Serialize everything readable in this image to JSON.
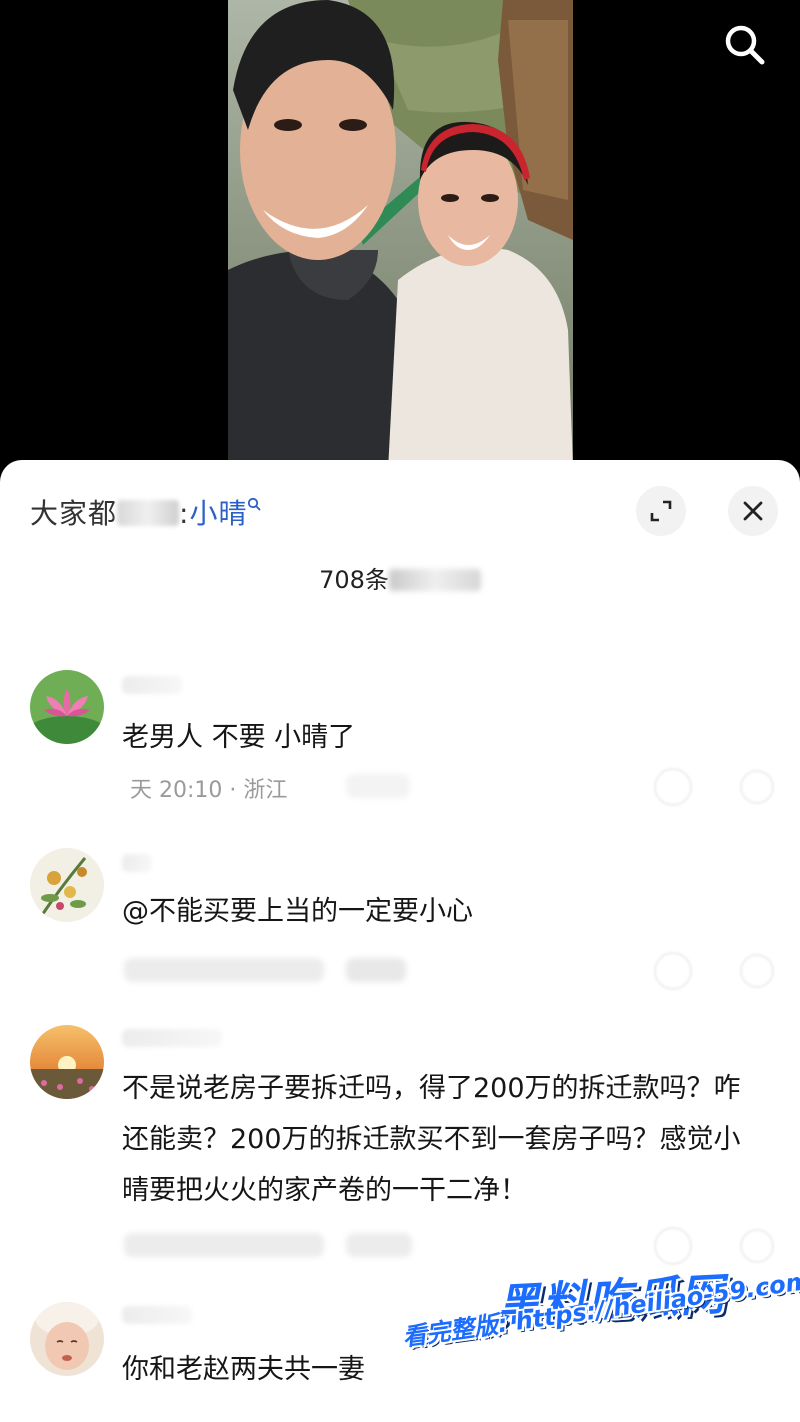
{
  "search": {
    "icon": "search-icon"
  },
  "header": {
    "prefix": "大家都",
    "colon": ":",
    "term": "小晴",
    "expand_icon": "expand-icon",
    "close_icon": "close-icon"
  },
  "comments_header": {
    "count": "708",
    "unit": "条"
  },
  "comments": [
    {
      "text": "老男人 不要 小晴了",
      "time": "天 20:10",
      "location": "浙江",
      "avatar": "lotus-avatar"
    },
    {
      "text": "@不能买要上当的一定要小心",
      "avatar": "flower-painting-avatar"
    },
    {
      "text": "不是说老房子要拆迁吗，得了200万的拆迁款吗？咋还能卖？200万的拆迁款买不到一套房子吗？感觉小晴要把火火的家产卷的一干二净！",
      "avatar": "sunset-avatar"
    },
    {
      "text": "你和老赵两夫共一妻",
      "avatar": "baby-avatar"
    }
  ],
  "watermark": {
    "title": "黑料吃瓜网",
    "url": "看完整版: https://heiliao-59.com"
  },
  "colors": {
    "accent": "#2b61c6",
    "watermark": "#1b6cff"
  }
}
